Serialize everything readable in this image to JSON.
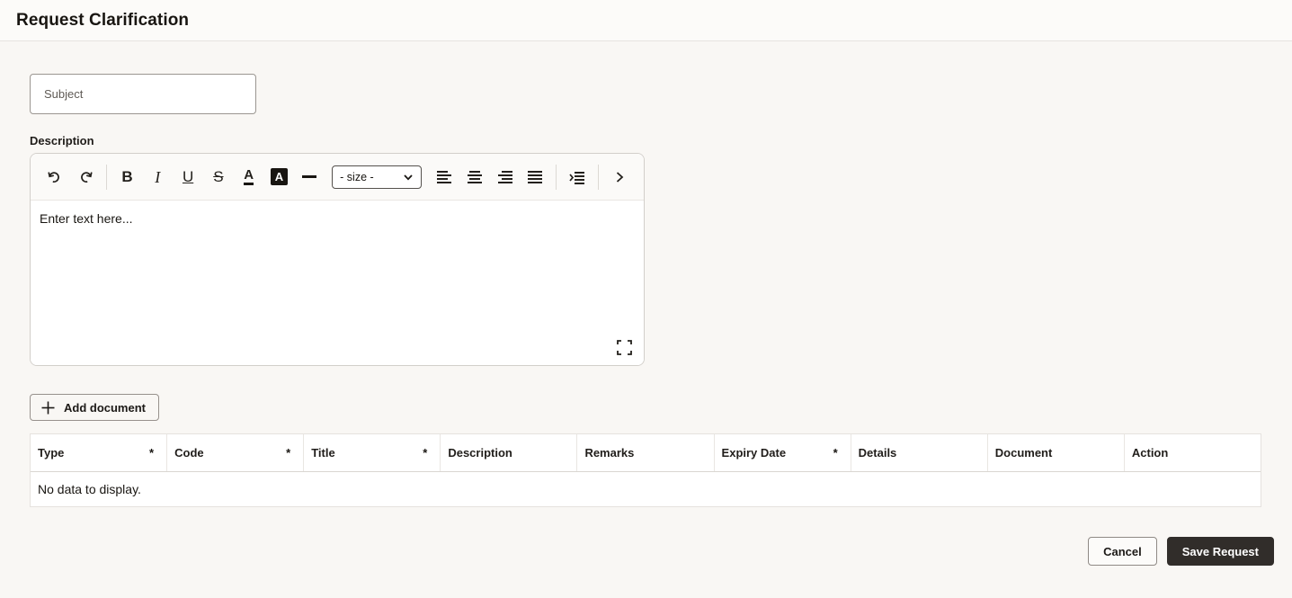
{
  "header": {
    "title": "Request Clarification"
  },
  "form": {
    "subject": {
      "placeholder": "Subject",
      "value": ""
    },
    "description_label": "Description",
    "editor": {
      "placeholder": "Enter text here...",
      "toolbar": {
        "bold_glyph": "B",
        "italic_glyph": "I",
        "underline_glyph": "U",
        "strikethrough_glyph": "S",
        "font_color_glyph": "A",
        "background_color_glyph": "A",
        "size_dropdown_value": "- size -"
      }
    },
    "add_document_label": "Add document"
  },
  "table": {
    "required_marker": "*",
    "columns": [
      {
        "label": "Type",
        "required": true
      },
      {
        "label": "Code",
        "required": true
      },
      {
        "label": "Title",
        "required": true
      },
      {
        "label": "Description",
        "required": false
      },
      {
        "label": "Remarks",
        "required": false
      },
      {
        "label": "Expiry Date",
        "required": true
      },
      {
        "label": "Details",
        "required": false
      },
      {
        "label": "Document",
        "required": false
      },
      {
        "label": "Action",
        "required": false
      }
    ],
    "empty_message": "No data to display."
  },
  "footer": {
    "cancel_label": "Cancel",
    "save_label": "Save Request"
  },
  "colors": {
    "primary_button": "#312d2a",
    "page_background": "#f9f7f4",
    "table_border": "#e5e2de",
    "text": "#1c1916"
  }
}
